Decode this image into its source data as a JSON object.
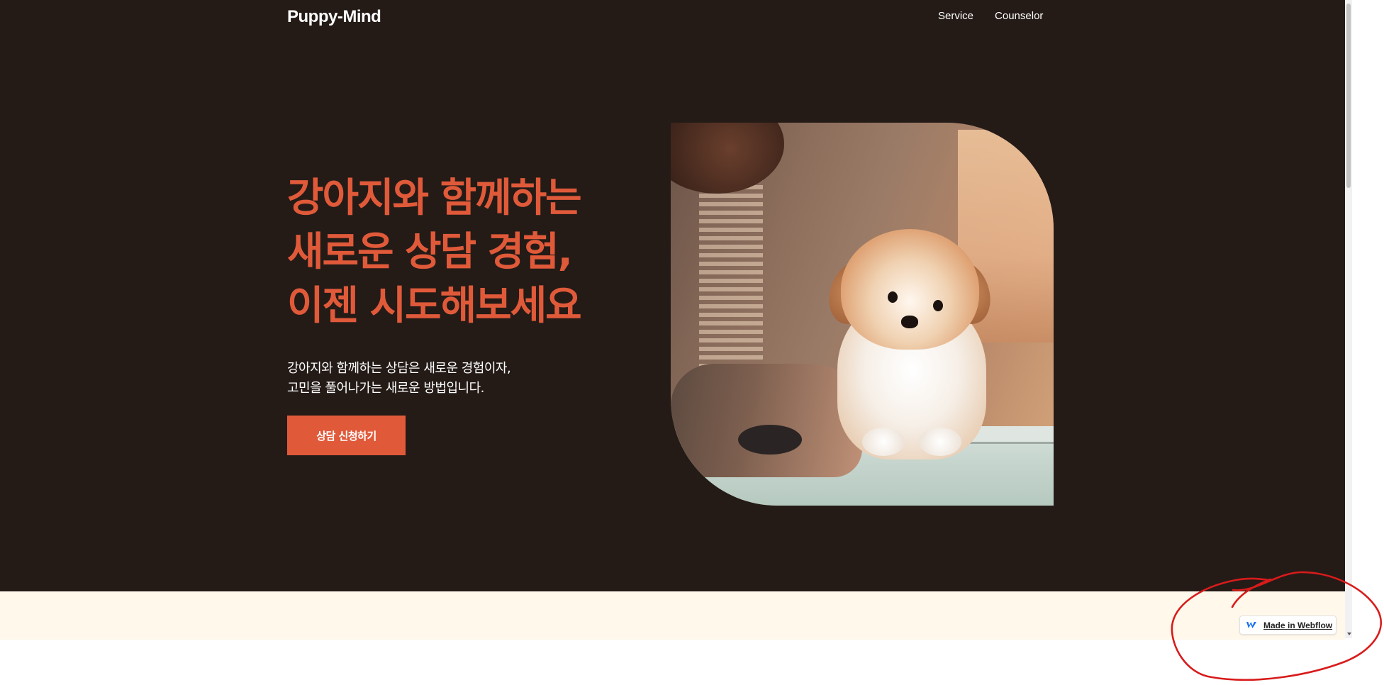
{
  "header": {
    "brand": "Puppy-Mind",
    "nav": [
      "Service",
      "Counselor"
    ]
  },
  "hero": {
    "headline": [
      "강아지와 함께하는",
      "새로운 상담 경험,",
      "이젠 시도해보세요"
    ],
    "subtext": [
      "강아지와 함께하는 상담은 새로운 경험이자,",
      "고민을 풀어나가는 새로운 방법입니다."
    ],
    "cta_label": "상담 신청하기",
    "image_icon": "puppy-photo"
  },
  "badge": {
    "label": "Made in Webflow",
    "icon": "webflow-logo-icon"
  },
  "colors": {
    "hero_bg": "#241b17",
    "accent": "#e05a3a",
    "band_bg": "#fff8eb",
    "annotation": "#d81b1b"
  }
}
